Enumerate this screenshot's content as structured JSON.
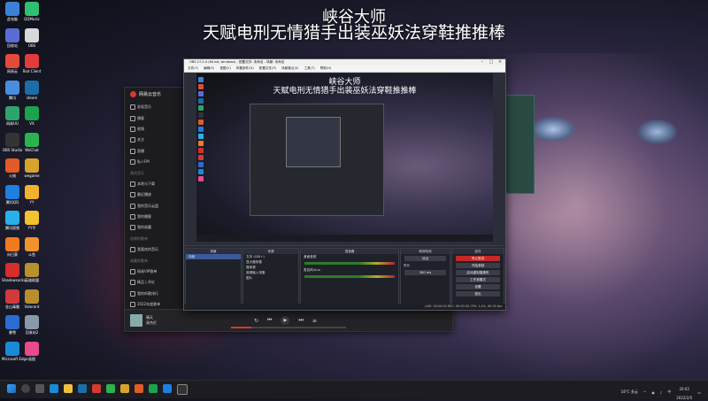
{
  "overlay": {
    "line1": "峡谷大师",
    "line2": "天赋电刑无情猎手出装巫妖法穿鞋推推棒"
  },
  "desktop_icons": [
    {
      "label": "此电脑",
      "color": "#3b82d6"
    },
    {
      "label": "QQMusic",
      "color": "#2fbf71"
    },
    {
      "label": "回收站",
      "color": "#5b6bd6"
    },
    {
      "label": "OBS",
      "color": "#d8d8d8"
    },
    {
      "label": "网易云",
      "color": "#e24a3b"
    },
    {
      "label": "Riot Client",
      "color": "#e23b3b"
    },
    {
      "label": "腾讯",
      "color": "#4a8de0"
    },
    {
      "label": "steam",
      "color": "#1b6ea8"
    },
    {
      "label": "网易UU",
      "color": "#2ea36b"
    },
    {
      "label": "VX",
      "color": "#1ba34d"
    },
    {
      "label": "OBS Studio",
      "color": "#333"
    },
    {
      "label": "WeChat",
      "color": "#2bb34f"
    },
    {
      "label": "火绒",
      "color": "#e25a27"
    },
    {
      "label": "wegame",
      "color": "#d6a32b"
    },
    {
      "label": "腾讯QQ",
      "color": "#1d7fe0"
    },
    {
      "label": "YY",
      "color": "#f2b230"
    },
    {
      "label": "腾讯视频",
      "color": "#2ab0e8"
    },
    {
      "label": "YY平",
      "color": "#f2c230"
    },
    {
      "label": "向日葵",
      "color": "#f07b1e"
    },
    {
      "label": "斗鱼",
      "color": "#f0932a"
    },
    {
      "label": "Shadowsocks",
      "color": "#d62d2d"
    },
    {
      "label": "英雄联盟",
      "color": "#b8912c"
    },
    {
      "label": "金山毒霸",
      "color": "#d13a3a"
    },
    {
      "label": "Valorant",
      "color": "#b88d2c"
    },
    {
      "label": "暴雪",
      "color": "#2c6cd0"
    },
    {
      "label": "回收站2",
      "color": "#8899aa"
    },
    {
      "label": "Microsoft Edge",
      "color": "#1a8ad6"
    },
    {
      "label": "画图",
      "color": "#e84a8c"
    }
  ],
  "music_app": {
    "title": "网易云音乐",
    "nav": [
      {
        "label": "发现音乐",
        "section": false
      },
      {
        "label": "播客",
        "section": false
      },
      {
        "label": "视频",
        "section": false
      },
      {
        "label": "关注",
        "section": false
      },
      {
        "label": "直播",
        "section": false
      },
      {
        "label": "私人FM",
        "section": false
      },
      {
        "label": "我的音乐",
        "section": true
      },
      {
        "label": "本地与下载",
        "section": false
      },
      {
        "label": "最近播放",
        "section": false
      },
      {
        "label": "我的音乐云盘",
        "section": false
      },
      {
        "label": "我的播客",
        "section": false
      },
      {
        "label": "我的收藏",
        "section": false
      },
      {
        "label": "创建的歌单",
        "section": true
      },
      {
        "label": "我喜欢的音乐",
        "section": false
      },
      {
        "label": "收藏的歌单",
        "section": true
      },
      {
        "label": "网易VIP歌单",
        "section": false
      },
      {
        "label": "精品 | 评论",
        "section": false
      },
      {
        "label": "我的听歌排行",
        "section": false
      },
      {
        "label": "2022年度歌单",
        "section": false
      }
    ],
    "player": {
      "song": "晴天",
      "artist": "周杰伦"
    }
  },
  "obs": {
    "title": "OBS 27.2.4 (64-bit, windows) - 配置文件: 未命名 - 场景: 未命名",
    "menu": [
      "文件(F)",
      "编辑(E)",
      "视图(V)",
      "停靠部件(D)",
      "配置文件(P)",
      "场景集合(S)",
      "工具(T)",
      "帮助(H)"
    ],
    "preview": {
      "line1": "峡谷大师",
      "line2": "天赋电刑无情猎手出装巫妖法穿鞋推推棒"
    },
    "docks": {
      "scenes_title": "场景",
      "scenes": [
        "场景"
      ],
      "sources_title": "来源",
      "sources": [
        "文本 (GDI+)",
        "显示器采集",
        "媒体源",
        "音频输入采集",
        "图片"
      ],
      "mixer_title": "混音器",
      "mixer_channels": [
        "桌面音频",
        "麦克风/Aux"
      ],
      "transitions_title": "转场特效",
      "transition_value": "淡出",
      "duration_label": "时长",
      "duration_value": "300 ms",
      "controls_title": "控件",
      "controls": [
        "停止推流",
        "开始录制",
        "启动虚拟摄像机",
        "工作室模式",
        "设置",
        "退出"
      ]
    },
    "status": "LIVE: 00:00:00  REC: 00:00:00  CPU: 1.4%, 60.00 fps"
  },
  "taskbar": {
    "weather": "18°C 多云",
    "time": "20:02",
    "date": "2022/2/5"
  }
}
